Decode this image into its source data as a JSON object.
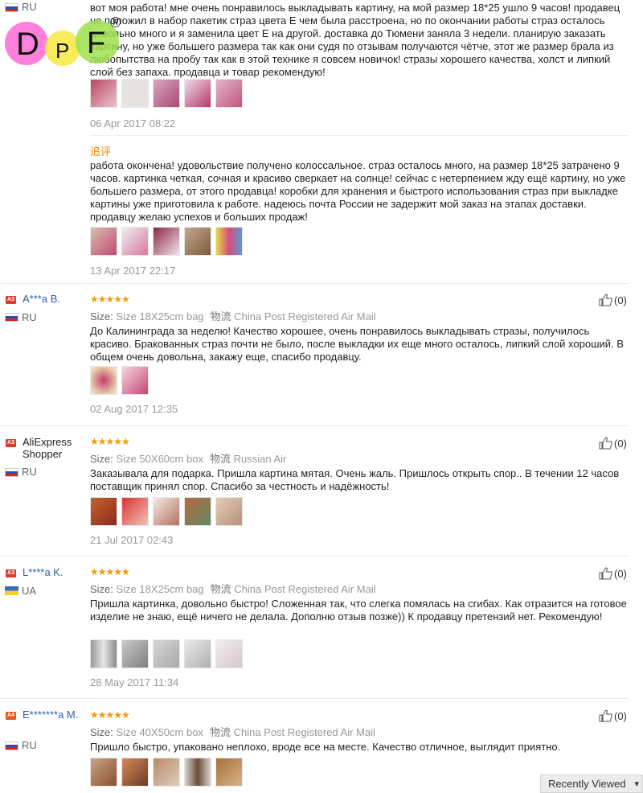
{
  "colors": {
    "link": "#2b5ea8",
    "star": "#f39a0a",
    "additional": "#e78b0c",
    "badge": "#e2392c"
  },
  "watermark": {
    "text": "DPF",
    "registered": "®"
  },
  "top_review": {
    "country": "RU",
    "text": "вот моя работа! мне очень понравилось выкладывать картину, на мой размер 18*25 ушло 9 часов! продавец не положил в набор пакетик страз цвета Е чем была расстроена, но по окончании работы страз осталось довольно много и я заменила цвет Е на другой. доставка до Тюмени заняла 3 недели. планирую заказать картину, но уже большего размера так как они судя по отзывам получаются чётче, этот же размер брала из любопытства на пробу так как в этой технике я совсем новичок! стразы хорошего качества, холст и липкий слой без запаха. продавца и товар рекомендую!",
    "date": "06 Apr 2017 08:22",
    "additional_label": "追评",
    "additional_text": "работа окончена! удовольствие получено колоссальное. страз осталось много, на размер 18*25 затрачено 9 часов. картинка четкая, сочная и красиво сверкает на солнце! сейчас с нетерпением жду ещё картину, но уже большего размера, от этого продавца! коробки для хранения и быстрого использования страз при выкладке картины уже приготовила к работе. надеюсь почта России не задержит мой заказ на этапах доставки. продавцу желаю успехов и больших продаж!",
    "additional_date": "13 Apr 2017 22:17"
  },
  "labels": {
    "size": "Size:",
    "shipping": "物流"
  },
  "reviews": [
    {
      "level": "A3",
      "name": "A***a B.",
      "country": "RU",
      "stars": "★★★★★",
      "size": "Size 18X25cm bag",
      "shipping": "China Post Registered Air Mail",
      "text": "До Калининграда за неделю! Качество хорошее, очень понравилось выкладывать стразы, получилось красиво. Бракованных страз почти не было, после выкладки их еще много осталось, липкий слой хороший. В общем очень довольна, закажу еще, спасибо продавцу.",
      "date": "02 Aug 2017 12:35",
      "likes": "(0)"
    },
    {
      "level": "A3",
      "name": "AliExpress Shopper",
      "country": "RU",
      "stars": "★★★★★",
      "size": "Size 50X60cm box",
      "shipping": "Russian Air",
      "text": "Заказывала для подарка. Пришла картина мятая. Очень жаль. Пришлось открыть спор.. В течении 12 часов поставщик принял спор. Спасибо за честность и надёжность!",
      "date": "21 Jul 2017 02:43",
      "likes": "(0)"
    },
    {
      "level": "A3",
      "name": "L****a K.",
      "country": "UA",
      "stars": "★★★★★",
      "size": "Size 18X25cm bag",
      "shipping": "China Post Registered Air Mail",
      "text": "Пришла картинка, довольно быстро! Сложенная так, что слегка помялась на сгибах. Как отразится на готовое изделие не знаю, ещё ничего не делала. Дополню отзыв позже)) К продавцу претензий нет. Рекомендую!",
      "date": "28 May 2017 11:34",
      "likes": "(0)"
    },
    {
      "level": "A4",
      "name": "E*******a M.",
      "country": "RU",
      "stars": "★★★★★",
      "size": "Size 40X50cm box",
      "shipping": "China Post Registered Air Mail",
      "text": "Пришло быстро, упаковано неплохо, вроде все на месте. Качество отличное, выглядит приятно.",
      "date": "",
      "likes": "(0)"
    }
  ],
  "recently_viewed": "Recently Viewed"
}
